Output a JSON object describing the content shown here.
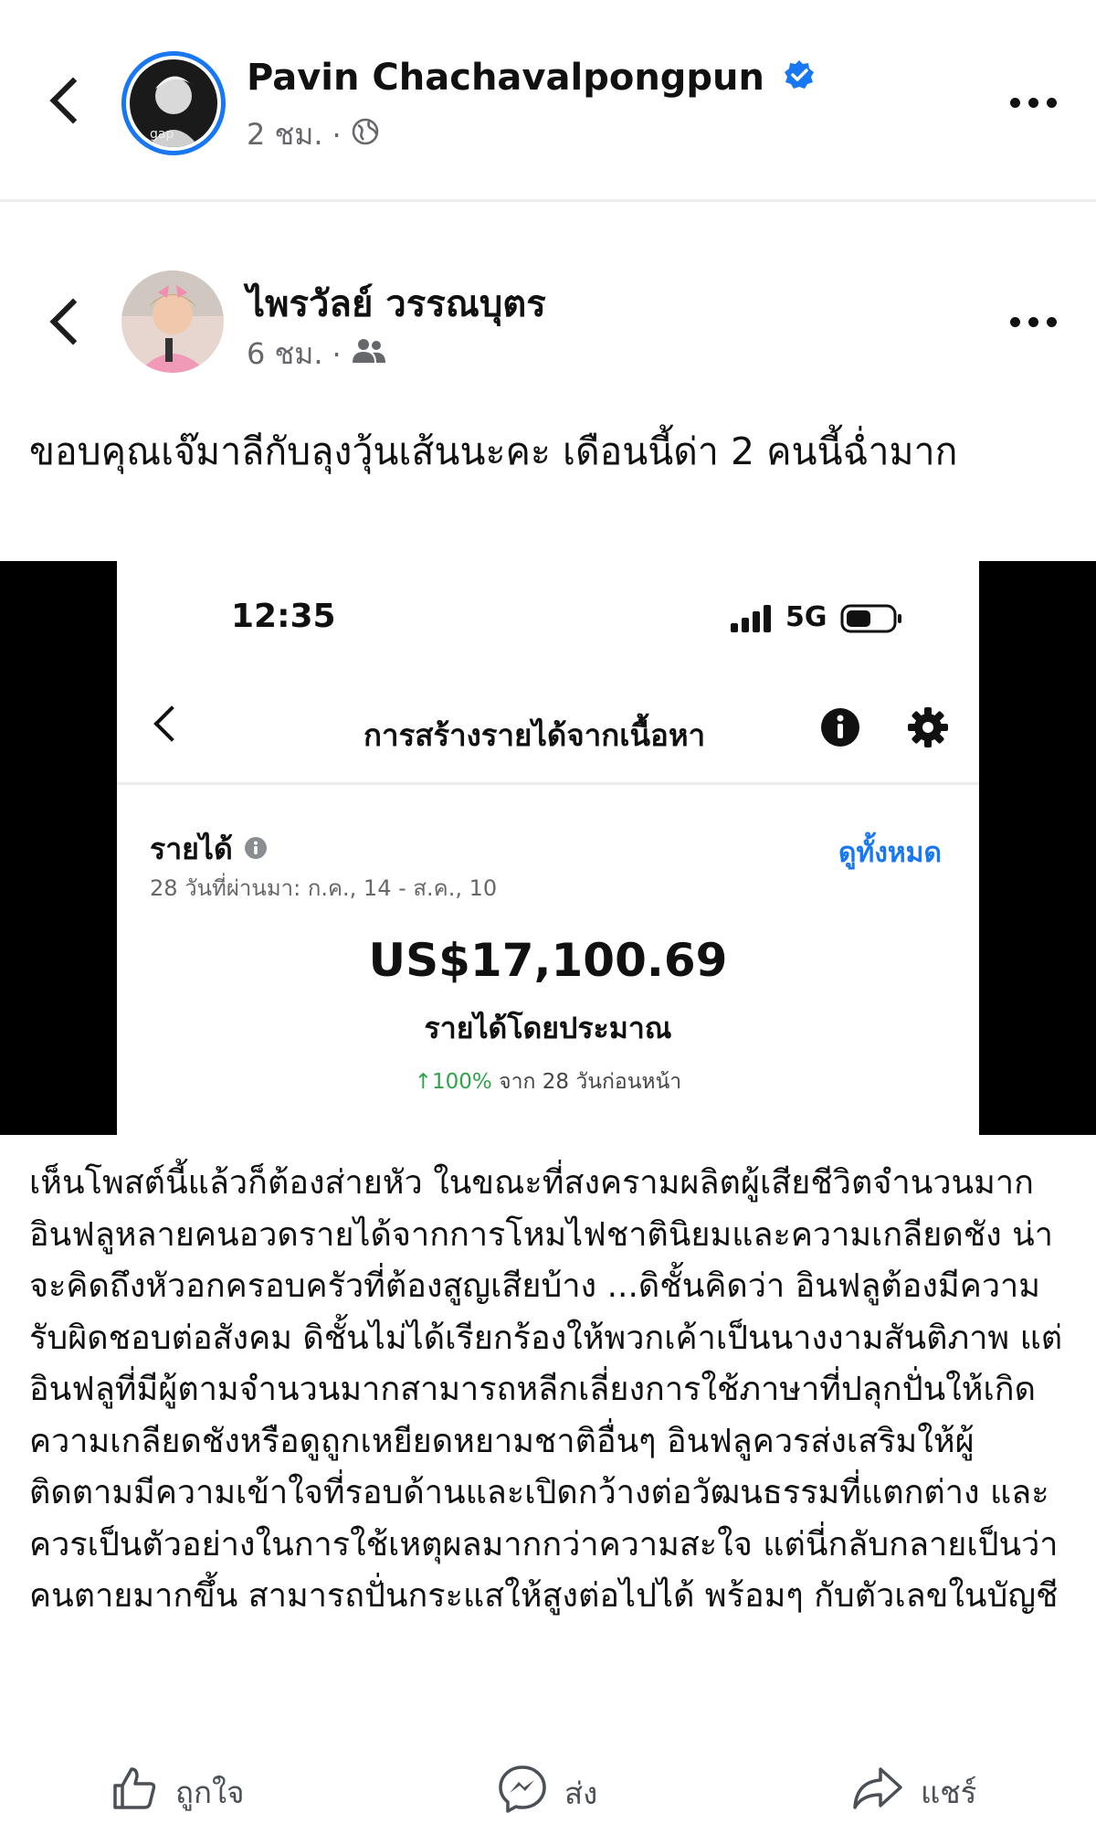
{
  "outer_post": {
    "author": "Pavin Chachavalpongpun",
    "time": "2 ชม.",
    "separator": "·",
    "verified": true,
    "accent_color": "#1877f2"
  },
  "inner_post": {
    "author": "ไพรวัลย์ วรรณบุตร",
    "time": "6 ชม.",
    "separator": "·",
    "caption": "ขอบคุณเจ๊มาลีกับลุงวุ้นเส้นนะคะ เดือนนี้ด่า 2 คนนี้ฉ่ำมาก"
  },
  "screenshot": {
    "status_time": "12:35",
    "network": "5G",
    "nav_title": "การสร้างรายได้จากเนื้อหา",
    "earnings_label": "รายได้",
    "period": "28 วันที่ผ่านมา: ก.ค., 14 - ส.ค., 10",
    "see_all": "ดูทั้งหมด",
    "amount": "US$17,100.69",
    "amount_label": "รายได้โดยประมาณ",
    "change_pct": "↑100%",
    "change_text": "จาก 28 วันก่อนหน้า"
  },
  "commentary": "เห็นโพสต์นี้แล้วก็ต้องส่ายหัว ในขณะที่สงครามผลิตผู้เสียชีวิตจำนวนมาก อินฟลูหลายคนอวดรายได้จากการโหมไฟชาตินิยมและความเกลียดชัง น่าจะคิดถึงหัวอกครอบครัวที่ต้องสูญเสียบ้าง ...ดิชั้นคิดว่า อินฟลูต้องมีความรับผิดชอบต่อสังคม ดิชั้นไม่ได้เรียกร้องให้พวกเค้าเป็นนางงามสันติภาพ แต่อินฟลูที่มีผู้ตามจำนวนมากสามารถหลีกเลี่ยงการใช้ภาษาที่ปลุกปั่นให้เกิดความเกลียดชังหรือดูถูกเหยียดหยามชาติอื่นๆ อินฟลูควรส่งเสริมให้ผู้ติดตามมีความเข้าใจที่รอบด้านและเปิดกว้างต่อวัฒนธรรมที่แตกต่าง และควรเป็นตัวอย่างในการใช้เหตุผลมากกว่าความสะใจ แต่นี่กลับกลายเป็นว่าคนตายมากขึ้น สามารถปั่นกระแสให้สูงต่อไปได้ พร้อมๆ กับตัวเลขในบัญชี",
  "actions": {
    "like": "ถูกใจ",
    "send": "ส่ง",
    "share": "แชร์"
  },
  "icons": {
    "back": "chevron-left-icon",
    "verified": "verified-badge-icon",
    "globe": "globe-icon",
    "friends": "friends-icon",
    "more": "more-dots-icon",
    "info": "info-icon",
    "settings": "gear-icon",
    "like": "thumbs-up-icon",
    "send": "messenger-icon",
    "share": "share-arrow-icon"
  }
}
